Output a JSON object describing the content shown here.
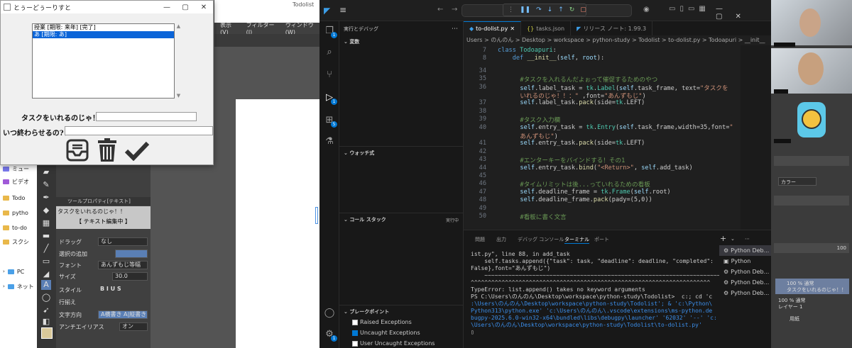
{
  "tk_window": {
    "title": "とぅーどぅーりすと",
    "listbox_items": [
      "授業 [期限: 来年] [完了]",
      "あ [期限: あ]"
    ],
    "selected_index": 1,
    "task_label": "タスクをいれるのじゃ！！：",
    "deadline_label": "いつ終わらせるの?：",
    "icons": [
      "inbox-icon",
      "trash-icon",
      "check-icon"
    ]
  },
  "explorer": {
    "items": [
      "ミュー",
      "ビデオ",
      "Todo",
      "pytho",
      "to-do",
      "スクシ",
      "PC",
      "ネット"
    ]
  },
  "csp": {
    "title": "Todolist",
    "menu": [
      "表示(V)",
      "フィルター(I)",
      "ウィンドウ(W)"
    ],
    "tool_property_tabs": [
      "ツールプロパティ[テキスト]"
    ],
    "preview_text": "タスクをいれるのじゃ！！",
    "mode_label": "【 テキスト編集中 】",
    "rows": [
      {
        "label": "ドラッグ",
        "value": "なし"
      },
      {
        "label": "選択の追加",
        "value": ""
      },
      {
        "label": "フォント",
        "value": "あんずもじ等幅"
      },
      {
        "label": "サイズ",
        "value": "30.0"
      },
      {
        "label": "スタイル",
        "value": "B I U S"
      },
      {
        "label": "行揃え",
        "value": ""
      },
      {
        "label": "文字方向",
        "value": "A横書き  A|縦書き"
      },
      {
        "label": "アンチエイリアス",
        "value": "オン"
      }
    ]
  },
  "vscode": {
    "debug_sidebar_title": "実行とデバッグ",
    "sections": {
      "variables": "変数",
      "watch": "ウォッチ式",
      "callstack": "コール スタック",
      "callstack_status": "実行中",
      "breakpoints": "ブレークポイント"
    },
    "breakpoints": [
      {
        "label": "Raised Exceptions",
        "checked": false
      },
      {
        "label": "Uncaught Exceptions",
        "checked": true
      },
      {
        "label": "User Uncaught Exceptions",
        "checked": false
      }
    ],
    "tabs": [
      {
        "label": "to-dolist.py",
        "active": true
      },
      {
        "label": "tasks.json",
        "active": false
      },
      {
        "label": "リリース ノート: 1.99.3",
        "active": false
      }
    ],
    "breadcrumb": "Users > のんのん > Desktop > workspace > python-study > Todolist > to-dolist.py > Todoapuri > __init__",
    "code_lines": [
      {
        "n": "7",
        "html": "<span class='kw'>class</span> <span class='cls'>Todoapuri</span>:"
      },
      {
        "n": "8",
        "html": "    <span class='kw'>def</span> <span class='fn'>__init__</span>(<span class='prm'>self</span>, <span class='prm'>root</span>):"
      },
      {
        "n": "34",
        "html": ""
      },
      {
        "n": "35",
        "html": "        <span class='cmt'>#タスクを入れるんだよぉって催促するためのやつ</span>"
      },
      {
        "n": "36",
        "html": "        <span class='prm'>self</span>.label_task = <span class='cls'>tk</span>.<span class='cls'>Label</span>(<span class='prm'>self</span>.task_frame, text=<span class='str'>\"タスクを</span>"
      },
      {
        "n": "",
        "html": "        <span class='str'>いれるのじゃ！！：\"</span> ,font=<span class='str'>\"あんずもじ\"</span>)"
      },
      {
        "n": "37",
        "html": "        <span class='prm'>self</span>.label_task.<span class='fn'>pack</span>(side=<span class='cls'>tk</span>.LEFT)"
      },
      {
        "n": "38",
        "html": ""
      },
      {
        "n": "39",
        "html": "        <span class='cmt'>#タスク入力欄</span>"
      },
      {
        "n": "40",
        "html": "        <span class='prm'>self</span>.entry_task = <span class='cls'>tk</span>.<span class='cls'>Entry</span>(<span class='prm'>self</span>.task_frame,width=35,font=<span class='str'>\"</span>"
      },
      {
        "n": "",
        "html": "        <span class='str'>あんずもじ\"</span>)"
      },
      {
        "n": "41",
        "html": "        <span class='prm'>self</span>.entry_task.<span class='fn'>pack</span>(side=<span class='cls'>tk</span>.LEFT)"
      },
      {
        "n": "42",
        "html": ""
      },
      {
        "n": "43",
        "html": "        <span class='cmt'>#エンターキーをバインドする！その1</span>"
      },
      {
        "n": "44",
        "html": "        <span class='prm'>self</span>.entry_task.<span class='fn'>bind</span>(<span class='str'>\"&lt;Return&gt;\"</span>, <span class='prm'>self</span>.add_task)"
      },
      {
        "n": "45",
        "html": ""
      },
      {
        "n": "46",
        "html": "        <span class='cmt'>#タイムリミットは後...っていれるための看板</span>"
      },
      {
        "n": "47",
        "html": "        <span class='prm'>self</span>.deadline_frame = <span class='cls'>tk</span>.<span class='cls'>Frame</span>(<span class='prm'>self</span>.root)"
      },
      {
        "n": "48",
        "html": "        <span class='prm'>self</span>.deadline_frame.<span class='fn'>pack</span>(pady=(5,0))"
      },
      {
        "n": "49",
        "html": ""
      },
      {
        "n": "50",
        "html": "        <span class='cmt'>#看板に書く文言</span>"
      }
    ],
    "panel_tabs": [
      "問題",
      "出力",
      "デバッグ コンソール",
      "ターミナル",
      "ポート"
    ],
    "active_panel_tab": "ターミナル",
    "terminal_lines": [
      {
        "cls": "",
        "t": "ist.py\", line 88, in add_task"
      },
      {
        "cls": "",
        "t": "    self.tasks.append({\"task\": task, \"deadline\": deadline, \"completed\":"
      },
      {
        "cls": "",
        "t": "False},font=\"あんずもじ\")"
      },
      {
        "cls": "",
        "t": "    ~~~~~~~~~~~~~~~~~~~~~~~~~~~~~~~~~~~~~~~~~~~~~~~~~~~~~~~~~~~~~~~~~~~~~~~"
      },
      {
        "cls": "",
        "t": "^^^^^^^^^^^^^^^^^^^^^^^^^^^^^^^^^^^^^^^^^^^^^^^^^^^^^^^^^^^^^^^^^^^^^^"
      },
      {
        "cls": "",
        "t": "TypeError: list.append() takes no keyword arguments"
      },
      {
        "cls": "",
        "t": "PS C:\\Users\\のんのん\\Desktop\\workspace\\python-study\\Todolist>  c:; cd 'c"
      },
      {
        "cls": "tblue",
        "t": ":\\Users\\のんのん\\Desktop\\workspace\\python-study\\Todolist'; & 'c:\\Python\\"
      },
      {
        "cls": "tblue",
        "t": "Python313\\python.exe' 'c:\\Users\\のんのん\\.vscode\\extensions\\ms-python.de"
      },
      {
        "cls": "tblue",
        "t": "bugpy-2025.6.0-win32-x64\\bundled\\libs\\debugpy\\launcher' '62032' '--' 'c:"
      },
      {
        "cls": "tblue",
        "t": "\\Users\\のんのん\\Desktop\\workspace\\python-study\\Todolist\\to-dolist.py'"
      },
      {
        "cls": "",
        "t": "▯"
      }
    ],
    "terminal_list": [
      "Python Deb...",
      "Python",
      "Python Deb...",
      "Python Deb...",
      "Python Deb..."
    ]
  },
  "right_panel": {
    "color_label": "カラー",
    "opacity_value": "100",
    "layer_name": "タスクをいれるのじゃ！！",
    "layer_mode": "100 % 通常",
    "layer2_mode": "100 % 通常",
    "layer2_name": "レイヤー 1",
    "paper_label": "用紙"
  }
}
